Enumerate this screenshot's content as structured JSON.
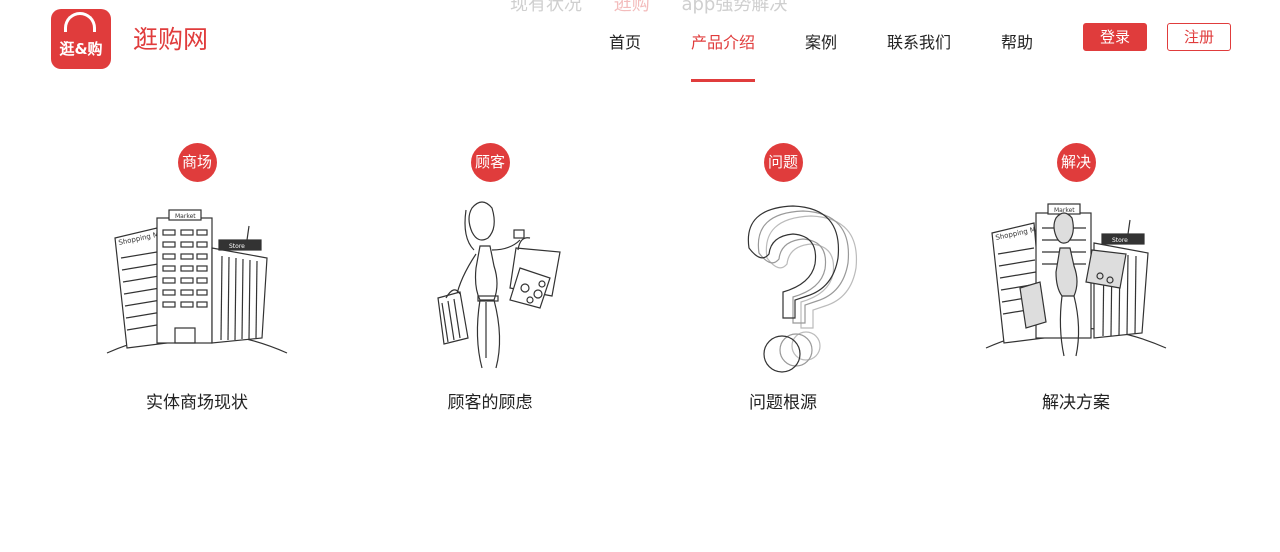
{
  "ghost_tabs": [
    "现有状况",
    "逛购",
    "app强势解决"
  ],
  "logo": {
    "text": "逛&购",
    "icon": "shopping-bag-icon"
  },
  "brand": "逛购网",
  "nav": [
    "首页",
    "产品介绍",
    "案例",
    "联系我们",
    "帮助"
  ],
  "active_nav": "产品介绍",
  "buttons": {
    "login": "登录",
    "register": "注册"
  },
  "cards": [
    {
      "badge": "商场",
      "caption": "实体商场现状",
      "illustration": "buildings-icon",
      "signs": [
        "Shopping Mall",
        "Market",
        "Store"
      ]
    },
    {
      "badge": "顾客",
      "caption": "顾客的顾虑",
      "illustration": "shopper-woman-icon"
    },
    {
      "badge": "问题",
      "caption": "问题根源",
      "illustration": "question-mark-icon"
    },
    {
      "badge": "解决",
      "caption": "解决方案",
      "illustration": "shopper-with-buildings-icon",
      "signs": [
        "Shopping Mall",
        "Market",
        "Store"
      ]
    }
  ],
  "colors": {
    "accent": "#e03c3c",
    "text": "#222222"
  }
}
